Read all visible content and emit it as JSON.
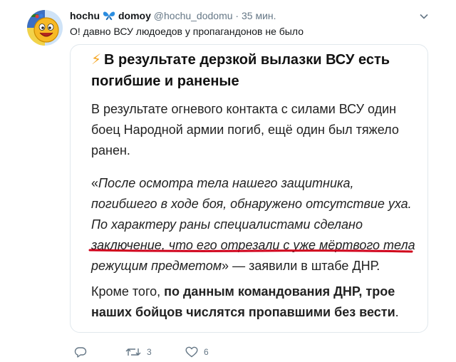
{
  "tweet": {
    "name_part1": "hochu",
    "butterfly_icon": "butterfly-emoji",
    "name_part2": "domoy",
    "handle": "@hochu_dodomu",
    "separator": "·",
    "time": "35 мин.",
    "text": "О! давно  ВСУ людоедов у пропагандонов не было"
  },
  "doc": {
    "bolt": "⚡",
    "title": "В результате дерзкой вылазки ВСУ есть погибшие и раненые",
    "para1": "В результате огневого контакта с силами ВСУ один боец Народной армии погиб, ещё один был тяжело ранен.",
    "quote_open": "«",
    "quote": "После осмотра тела нашего защитника, погибшего в ходе боя, обнаружено отсутствие уха. По характеру раны специалистами сделано заключение, что его отрезали с уже мёртвого тела режущим предметом",
    "quote_close": "»",
    "quote_tail": " — заявили в штабе ДНР.",
    "para3_start": "Кроме того, ",
    "para3_bold": "по данным командования ДНР, трое наших бойцов числятся пропавшими без вести",
    "para3_end": "."
  },
  "actions": {
    "reply_count": "",
    "retweet_count": "3",
    "like_count": "6"
  },
  "colors": {
    "accent_red": "#d0021b",
    "muted": "#657786",
    "border": "#e1e8ed"
  },
  "icons": [
    "avatar-smiley",
    "butterfly-icon",
    "chevron-down-icon",
    "reply-icon",
    "retweet-icon",
    "like-icon"
  ]
}
